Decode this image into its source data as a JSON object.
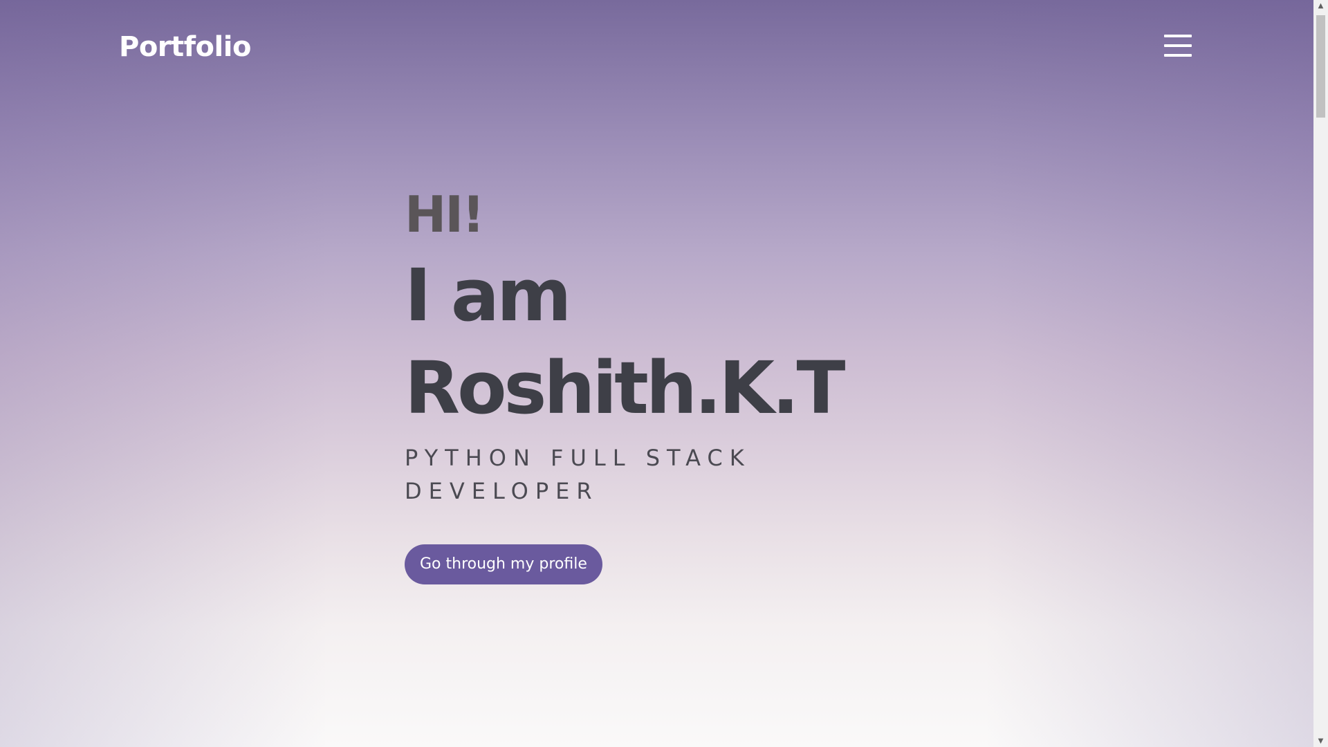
{
  "navbar": {
    "brand": "Portfolio",
    "menu_icon": "hamburger-menu-icon"
  },
  "hero": {
    "greeting": "HI!",
    "intro_line_1": "I am",
    "intro_line_2": "Roshith.K.T",
    "role": "PYTHON FULL STACK DEVELOPER",
    "cta_label": "Go through my profile"
  },
  "scrollbar": {
    "up_arrow": "▲",
    "down_arrow": "▼"
  },
  "colors": {
    "background_top": "#786a9c",
    "background_bottom": "#faf9f9",
    "brand_text": "#ffffff",
    "heading_text": "#3e3f47",
    "button_bg": "#6a5a9e",
    "button_text": "#ffffff"
  }
}
